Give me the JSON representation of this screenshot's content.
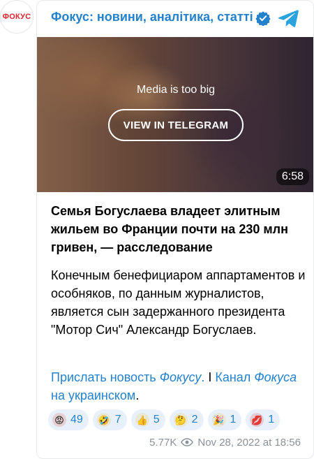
{
  "avatar": {
    "label": "ФОКУС"
  },
  "header": {
    "channel_title": "Фокус: новини, аналітика, статті"
  },
  "media": {
    "notice": "Media is too big",
    "button_label": "VIEW IN TELEGRAM",
    "duration": "6:58"
  },
  "post": {
    "title": "Семья Богуслаева владеет элитным жильем во Франции почти на 230 млн гривен, — расследование",
    "body": "Конечным бенефициаром аппартаментов и особняков, по данным журналистов, является сын задержанного президента \"Мотор Сич\" Александр Богуслаев.",
    "links": {
      "send_news_prefix": "Прислать новость ",
      "send_news_italic": "Фокусу",
      "send_news_suffix": ".",
      "separator": " I ",
      "channel_prefix": "Канал ",
      "channel_italic": "Фокуса",
      "channel_suffix": " на украинском",
      "end": "."
    }
  },
  "reactions": [
    {
      "emoji": "😡",
      "count": "49",
      "color": "#e04a2f"
    },
    {
      "emoji": "🤣",
      "count": "7",
      "color": "#f5c23a"
    },
    {
      "emoji": "👍",
      "count": "5",
      "color": "#f5c23a"
    },
    {
      "emoji": "🤔",
      "count": "2",
      "color": "#f5c23a"
    },
    {
      "emoji": "🎉",
      "count": "1",
      "color": "#f5c23a"
    },
    {
      "emoji": "💋",
      "count": "1",
      "color": "#e23a4c"
    }
  ],
  "meta": {
    "views": "5.77K",
    "date": "Nov 28, 2022 at 18:56"
  },
  "colors": {
    "accent": "#2481cc",
    "reaction_bg": "#e8f1fb",
    "meta_gray": "#8a9199",
    "brand_red": "#e3232c"
  },
  "icons": {
    "verified": "verified-badge-icon",
    "telegram": "telegram-plane-icon",
    "views": "eye-icon"
  }
}
